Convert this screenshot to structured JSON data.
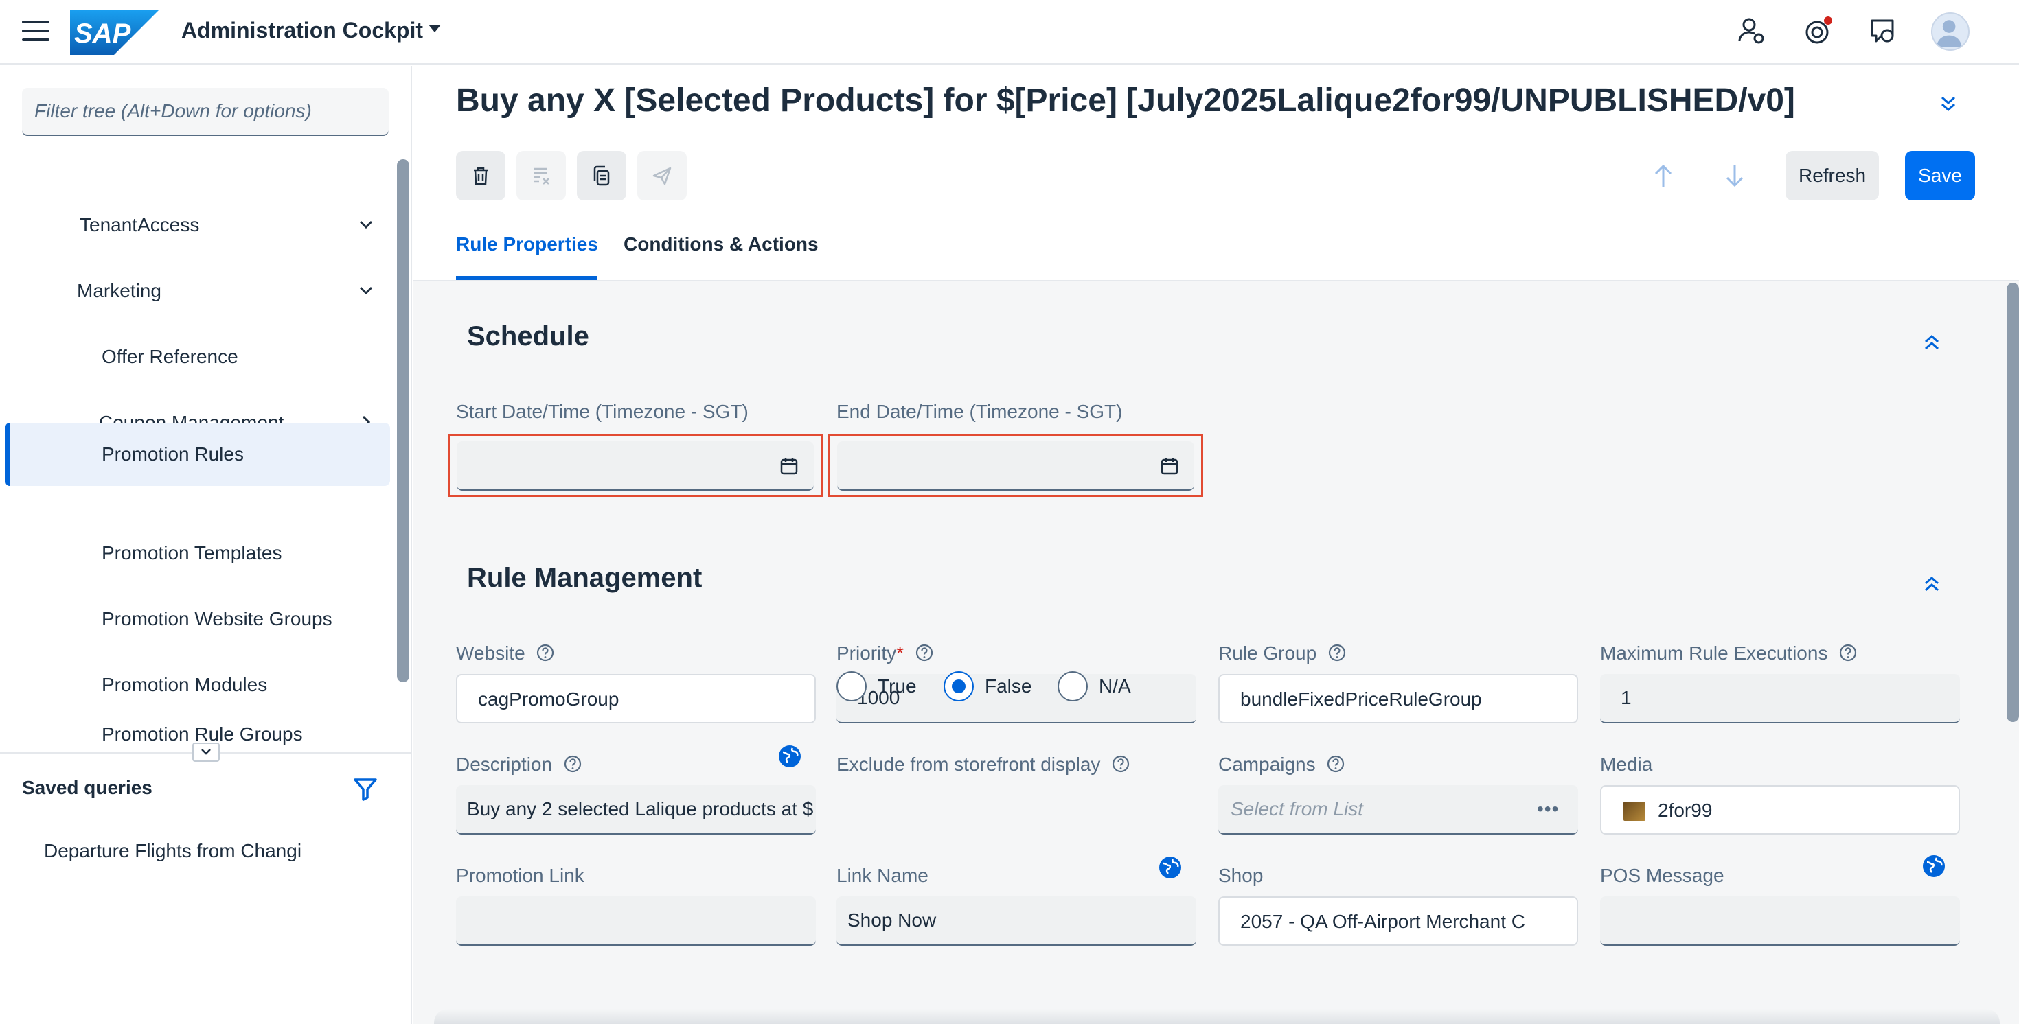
{
  "shell": {
    "logo_text": "SAP",
    "app_title": "Administration Cockpit"
  },
  "nav": {
    "filter_placeholder": "Filter tree (Alt+Down for options)",
    "items": [
      {
        "label": "TenantAccess"
      },
      {
        "label": "Marketing"
      },
      {
        "label": "Offer Reference"
      },
      {
        "label": "Coupon Management"
      },
      {
        "label": "Promotion Rules"
      },
      {
        "label": "Promotion Templates"
      },
      {
        "label": "Promotion Website Groups"
      },
      {
        "label": "Promotion Modules"
      },
      {
        "label": "Promotion Rule Groups"
      }
    ],
    "saved_queries_title": "Saved queries",
    "saved_queries": [
      {
        "label": "Departure Flights from Changi"
      }
    ]
  },
  "page": {
    "title": "Buy any X [Selected Products] for $[Price] [July2025Lalique2for99/UNPUBLISHED/v0]",
    "refresh_label": "Refresh",
    "save_label": "Save",
    "tabs": [
      {
        "label": "Rule Properties",
        "active": true
      },
      {
        "label": "Conditions & Actions",
        "active": false
      }
    ]
  },
  "schedule": {
    "title": "Schedule",
    "start_label": "Start Date/Time (Timezone - SGT)",
    "start_value": "",
    "end_label": "End Date/Time (Timezone - SGT)",
    "end_value": ""
  },
  "rule_management": {
    "title": "Rule Management",
    "website_label": "Website",
    "website_value": "cagPromoGroup",
    "priority_label": "Priority",
    "priority_required": "*",
    "priority_value": "1000",
    "rule_group_label": "Rule Group",
    "rule_group_value": "bundleFixedPriceRuleGroup",
    "max_exec_label": "Maximum Rule Executions",
    "max_exec_value": "1",
    "description_label": "Description",
    "description_value": "Buy any 2 selected Lalique products at $",
    "exclude_label": "Exclude from storefront display",
    "exclude_options": [
      "True",
      "False",
      "N/A"
    ],
    "exclude_selected": "False",
    "campaigns_label": "Campaigns",
    "campaigns_placeholder": "Select from List",
    "campaigns_more": "•••",
    "media_label": "Media",
    "media_value": "2for99",
    "promo_link_label": "Promotion Link",
    "promo_link_value": "",
    "link_name_label": "Link Name",
    "link_name_value": "Shop Now",
    "shop_label": "Shop",
    "shop_value": "2057 - QA Off-Airport Merchant C",
    "pos_label": "POS Message",
    "pos_value": ""
  },
  "colors": {
    "accent": "#0064d9",
    "save_button": "#0070f2",
    "error_outline": "#e24b32",
    "notification_dot": "#d0231b"
  }
}
